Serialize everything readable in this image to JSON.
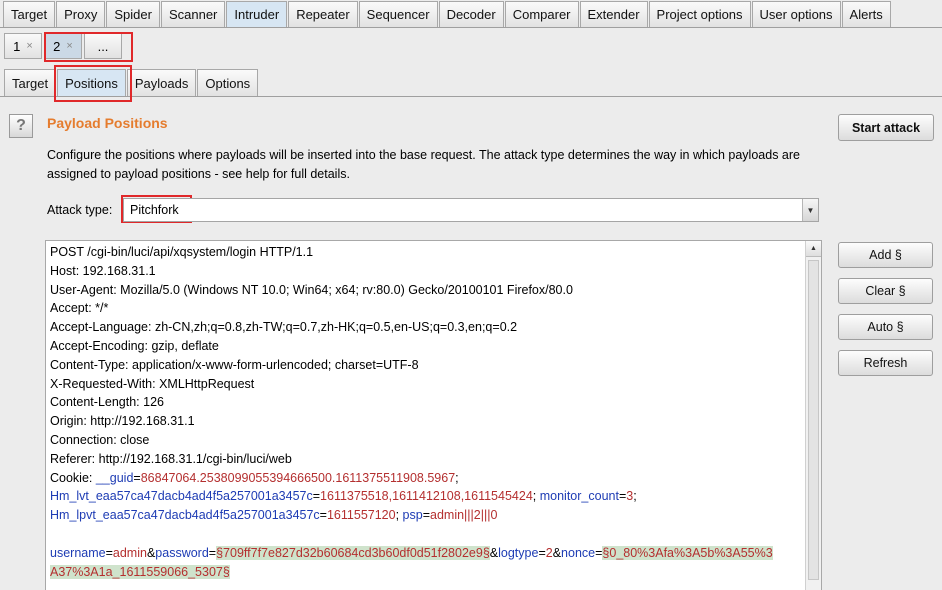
{
  "main_tabs": [
    "Target",
    "Proxy",
    "Spider",
    "Scanner",
    "Intruder",
    "Repeater",
    "Sequencer",
    "Decoder",
    "Comparer",
    "Extender",
    "Project options",
    "User options",
    "Alerts"
  ],
  "session_tabs": [
    {
      "label": "1",
      "close": "×"
    },
    {
      "label": "2",
      "close": "×"
    },
    {
      "label": "...",
      "close": ""
    }
  ],
  "sub_tabs": [
    "Target",
    "Positions",
    "Payloads",
    "Options"
  ],
  "panel": {
    "heading": "Payload Positions",
    "help": "?",
    "description": "Configure the positions where payloads will be inserted into the base request. The attack type determines the way in which payloads are assigned to payload positions - see help for full details.",
    "start_attack": "Start attack",
    "attack_type_label": "Attack type:",
    "attack_type_value": "Pitchfork"
  },
  "side_buttons": [
    "Add §",
    "Clear §",
    "Auto §",
    "Refresh"
  ],
  "request": {
    "line1": "POST /cgi-bin/luci/api/xqsystem/login HTTP/1.1",
    "line2": "Host: 192.168.31.1",
    "line3": "User-Agent: Mozilla/5.0 (Windows NT 10.0; Win64; x64; rv:80.0) Gecko/20100101 Firefox/80.0",
    "line4": "Accept: */*",
    "line5": "Accept-Language: zh-CN,zh;q=0.8,zh-TW;q=0.7,zh-HK;q=0.5,en-US;q=0.3,en;q=0.2",
    "line6": "Accept-Encoding: gzip, deflate",
    "line7": "Content-Type: application/x-www-form-urlencoded; charset=UTF-8",
    "line8": "X-Requested-With: XMLHttpRequest",
    "line9": "Content-Length: 126",
    "line10": "Origin: http://192.168.31.1",
    "line11": "Connection: close",
    "line12": "Referer: http://192.168.31.1/cgi-bin/luci/web",
    "cookie_label": "Cookie: ",
    "cookie_guid_name": "__guid",
    "cookie_guid_value": "86847064.2538099055394666500.1611375511908.5967",
    "cookie_lvt_name": "Hm_lvt_eaa57ca47dacb4ad4f5a257001a3457c",
    "cookie_lvt_value": "1611375518,1611412108,1611545424",
    "cookie_mc_name": "monitor_count",
    "cookie_mc_value": "3",
    "cookie_lpvt_name": "Hm_lpvt_eaa57ca47dacb4ad4f5a257001a3457c",
    "cookie_lpvt_value": "1611557120",
    "cookie_psp_name": "psp",
    "cookie_psp_value": "admin|||2|||0",
    "body_username_name": "username",
    "body_username_value": "admin",
    "body_password_name": "password",
    "body_password_value": "§709ff7f7e827d32b60684cd3b60df0d51f2802e9§",
    "body_logtype_name": "logtype",
    "body_logtype_value": "2",
    "body_nonce_name": "nonce",
    "body_nonce_value_a": "§0_80%3Afa%3A5b%3A55%3",
    "body_nonce_value_b": "A37%3A1a_1611559066_5307§"
  }
}
